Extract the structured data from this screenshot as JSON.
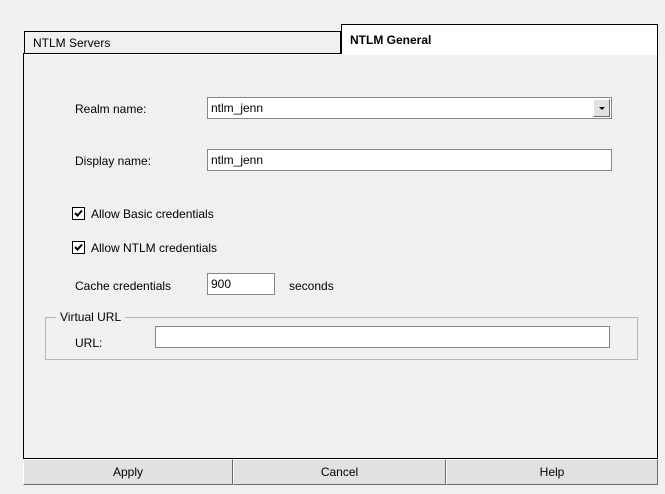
{
  "tabs": [
    {
      "label": "NTLM Servers"
    },
    {
      "label": "NTLM General"
    }
  ],
  "form": {
    "realm_label": "Realm name:",
    "realm_value": "ntlm_jenn",
    "display_label": "Display name:",
    "display_value": "ntlm_jenn",
    "allow_basic_label": "Allow Basic credentials",
    "allow_basic_checked": true,
    "allow_ntlm_label": "Allow NTLM credentials",
    "allow_ntlm_checked": true,
    "cache_label": "Cache credentials",
    "cache_value": "900",
    "cache_unit": "seconds",
    "virtual_url_legend": "Virtual URL",
    "url_label": "URL:",
    "url_value": ""
  },
  "footer": {
    "apply_label": "Apply",
    "cancel_label": "Cancel",
    "help_label": "Help"
  },
  "icons": {
    "combo_arrow": "chevron-down-icon",
    "checkmark": "checkmark-icon"
  }
}
